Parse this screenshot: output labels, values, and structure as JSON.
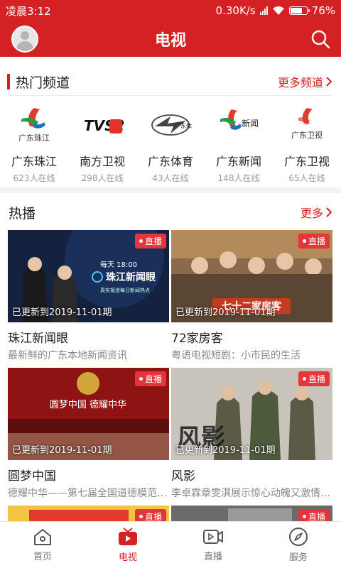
{
  "status_bar": {
    "time": "凌晨3:12",
    "speed": "0.30K/s",
    "battery": "76%",
    "battery_level": 0.76
  },
  "header": {
    "title": "电视"
  },
  "hot_channels": {
    "title": "热门频道",
    "more": "更多频道",
    "channels": [
      {
        "name": "广东珠江",
        "online": "623人在线",
        "logo_text": "广东珠江",
        "logo": "zhujiang-logo"
      },
      {
        "name": "南方卫视",
        "online": "298人在线",
        "logo_text": "TVS2",
        "logo": "tvs2-logo"
      },
      {
        "name": "广东体育",
        "online": "43人在线",
        "logo_text": "广东体育",
        "logo": "gd-sports-logo"
      },
      {
        "name": "广东新闻",
        "online": "148人在线",
        "logo_text": "新闻",
        "logo": "gd-news-logo"
      },
      {
        "name": "广东卫视",
        "online": "65人在线",
        "logo_text": "广东卫视",
        "logo": "gd-satellite-logo"
      }
    ]
  },
  "hot_play": {
    "title": "热播",
    "more": "更多",
    "live_label": "直播",
    "cards": [
      {
        "title": "珠江新闻眼",
        "desc": "最新鲜的广东本地新闻资讯",
        "updated": "已更新到2019-11-01期",
        "poster_text": "珠江新闻眼",
        "poster_sub": "每天 18:00",
        "poster_sub2": "真实报道每日新闻热点"
      },
      {
        "title": "72家房客",
        "desc": "粤语电视短剧：小市民的生活",
        "updated": "已更新到2019-11-01期",
        "poster_text": "七十二家房客"
      },
      {
        "title": "圆梦中国",
        "desc": "德耀中华——第七届全国道德模范与身边好人",
        "updated": "已更新到2019-11-01期",
        "poster_text": "圆梦中国 德耀中华"
      },
      {
        "title": "风影",
        "desc": "李卓霖章雯淇展示惊心动魄又激情燃烧的岁月",
        "updated": "已更新到2019-11-01期",
        "poster_text": "风影"
      }
    ]
  },
  "bottom_nav": [
    {
      "label": "首页",
      "icon": "home-icon"
    },
    {
      "label": "电视",
      "icon": "tv-icon",
      "active": true
    },
    {
      "label": "直播",
      "icon": "live-video-icon"
    },
    {
      "label": "服务",
      "icon": "compass-icon"
    }
  ],
  "colors": {
    "brand": "#d32124",
    "live_tag": "#e3353a"
  }
}
